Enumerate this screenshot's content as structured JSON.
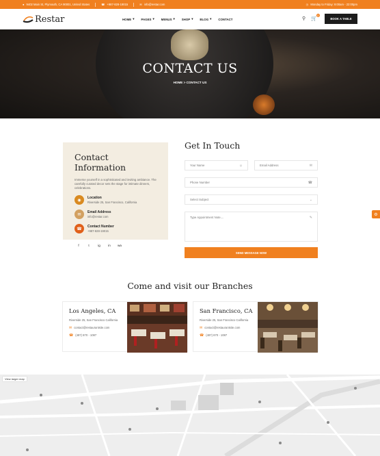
{
  "topbar": {
    "address": "9402 Main St, Plymouth, CA 90001, United States",
    "phone": "+987-828-19015",
    "email": "info@restar.com",
    "hours": "Monday to Friday: 9:00am - 22:00pm"
  },
  "nav": {
    "logo": "Restar",
    "menu": [
      "HOME",
      "PAGES",
      "MENUS",
      "SHOP",
      "BLOG",
      "CONTACT"
    ],
    "dropdowns": [
      true,
      true,
      true,
      true,
      true,
      false
    ],
    "cart_count": "0",
    "book_label": "BOOK A TABLE"
  },
  "hero": {
    "title": "CONTACT US",
    "breadcrumb": "HOME > CONTACT US"
  },
  "contact_info": {
    "title": "Contact Information",
    "description": "Immerse yourself in a sophisticated and inviting ambiance. The carefully curated decor sets the stage for intimate dinners, celebrations.",
    "items": [
      {
        "label": "Location",
        "value": "Riverside 25, San Francisco, California",
        "icon": "location-icon"
      },
      {
        "label": "Email Address",
        "value": "info@restar.com",
        "icon": "email-icon"
      },
      {
        "label": "Contact Number",
        "value": "+987-828-19015",
        "icon": "phone-icon"
      }
    ],
    "socials": [
      "f",
      "t",
      "ig",
      "in",
      "wa"
    ]
  },
  "form": {
    "title": "Get In Touch",
    "name_placeholder": "Your Name",
    "email_placeholder": "Email Address",
    "phone_placeholder": "Phone Number",
    "subject_placeholder": "Select Subject",
    "note_placeholder": "Type Appointment Note....",
    "submit_label": "SEND MESSAGE NOW"
  },
  "branches": {
    "title": "Come and visit our Branches",
    "items": [
      {
        "city": "Los Angeles, CA",
        "address": "Riverside 25, San Francisco California",
        "email": "contact@restaurantsite.com",
        "phone": "(487) 870 - 1087"
      },
      {
        "city": "San Francisco, CA",
        "address": "Riverside 25, San Francisco California",
        "email": "contact@restaurantsite.com",
        "phone": "(487) 870 - 1087"
      }
    ]
  },
  "map": {
    "view_larger": "View larger map"
  },
  "colors": {
    "accent": "#f0801f",
    "dark": "#1c1c1c",
    "info_bg": "#f3ede1"
  }
}
